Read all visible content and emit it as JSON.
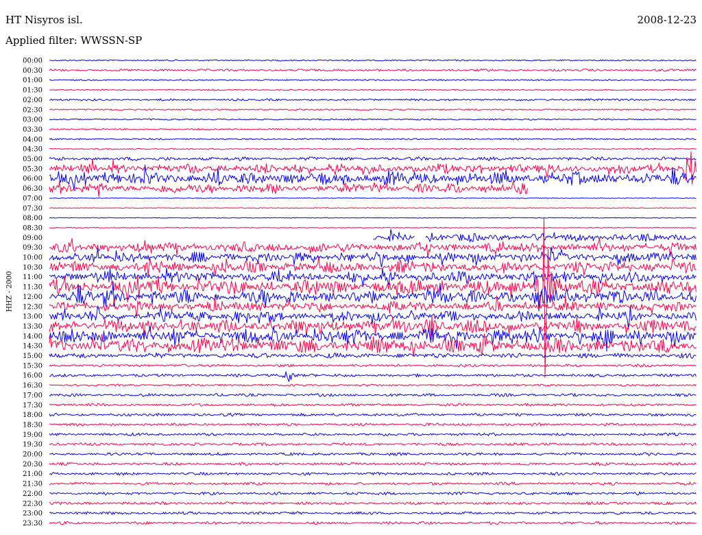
{
  "header": {
    "station": "HT Nisyros isl.",
    "date": "2008-12-23",
    "filter": "Applied filter: WWSSN-SP",
    "channel_label": "HHZ - 2000"
  },
  "chart_data": {
    "type": "line",
    "title": "HT Nisyros isl.",
    "subtitle": "Applied filter: WWSSN-SP",
    "date": "2008-12-23",
    "ylabel": "HHZ - 2000",
    "xlabel": "",
    "grid": false,
    "colors": [
      "#0000ee",
      "#ff0044"
    ],
    "row_interval_minutes": 30,
    "categories": [
      "00:00",
      "00:30",
      "01:00",
      "01:30",
      "02:00",
      "02:30",
      "03:00",
      "03:30",
      "04:00",
      "04:30",
      "05:00",
      "05:30",
      "06:00",
      "06:30",
      "07:00",
      "07:30",
      "08:00",
      "08:30",
      "09:00",
      "09:30",
      "10:00",
      "10:30",
      "11:00",
      "11:30",
      "12:00",
      "12:30",
      "13:00",
      "13:30",
      "14:00",
      "14:30",
      "15:00",
      "15:30",
      "16:00",
      "16:30",
      "17:00",
      "17:30",
      "18:00",
      "18:30",
      "19:00",
      "19:30",
      "20:00",
      "20:30",
      "21:00",
      "21:30",
      "22:00",
      "22:30",
      "23:00",
      "23:30"
    ],
    "activity": [
      0.5,
      1.2,
      0.4,
      0.4,
      1,
      0.6,
      0.6,
      0.6,
      0.6,
      0.5,
      2,
      6,
      8,
      6,
      0,
      0,
      0,
      0,
      5,
      6,
      6,
      7,
      7,
      9,
      9,
      6,
      6,
      8,
      9,
      9,
      3,
      1.5,
      1.5,
      1,
      1.5,
      1.5,
      1.5,
      1.5,
      1.5,
      1.5,
      1.5,
      1.5,
      1.5,
      1.5,
      1.5,
      1.5,
      1.5,
      1.5
    ],
    "data_gaps": [
      {
        "row": "06:30",
        "from": 0.74,
        "to": 1.0
      },
      {
        "row": "09:00",
        "from": 0.0,
        "to": 0.5
      },
      {
        "row": "09:00",
        "from": 0.565,
        "to": 0.58
      }
    ],
    "events": [
      {
        "row": "11:30",
        "position": 0.765,
        "amplitude": 160
      },
      {
        "row": "16:00",
        "position": 0.37,
        "amplitude": 14
      },
      {
        "row": "13:30",
        "position": 0.59,
        "amplitude": 25
      },
      {
        "row": "05:30",
        "position": 0.99,
        "amplitude": 45
      }
    ]
  }
}
